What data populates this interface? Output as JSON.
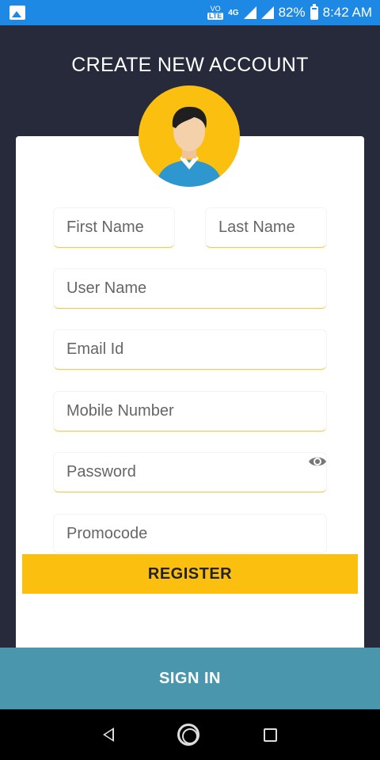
{
  "status_bar": {
    "volte_top": "VO",
    "volte_bottom": "LTE",
    "network": "4G",
    "battery": "82%",
    "time": "8:42 AM",
    "battery_level": 0.82
  },
  "header": {
    "title": "CREATE NEW ACCOUNT"
  },
  "form": {
    "first_name_placeholder": "First Name",
    "last_name_placeholder": "Last Name",
    "user_name_placeholder": "User Name",
    "email_placeholder": "Email Id",
    "mobile_placeholder": "Mobile Number",
    "password_placeholder": "Password",
    "promocode_placeholder": "Promocode",
    "register_label": "REGISTER"
  },
  "footer": {
    "signin_label": "SIGN IN"
  },
  "colors": {
    "status_bar": "#1e88e5",
    "background": "#262a3b",
    "accent_yellow": "#fbbf10",
    "signin_bar": "#4a96ad"
  },
  "icons": {
    "gallery": "image-icon",
    "signal": "signal-icon",
    "battery": "battery-icon",
    "avatar": "user-avatar-icon",
    "eye": "eye-icon",
    "back": "back-icon",
    "home": "home-icon",
    "recent": "recent-apps-icon"
  }
}
